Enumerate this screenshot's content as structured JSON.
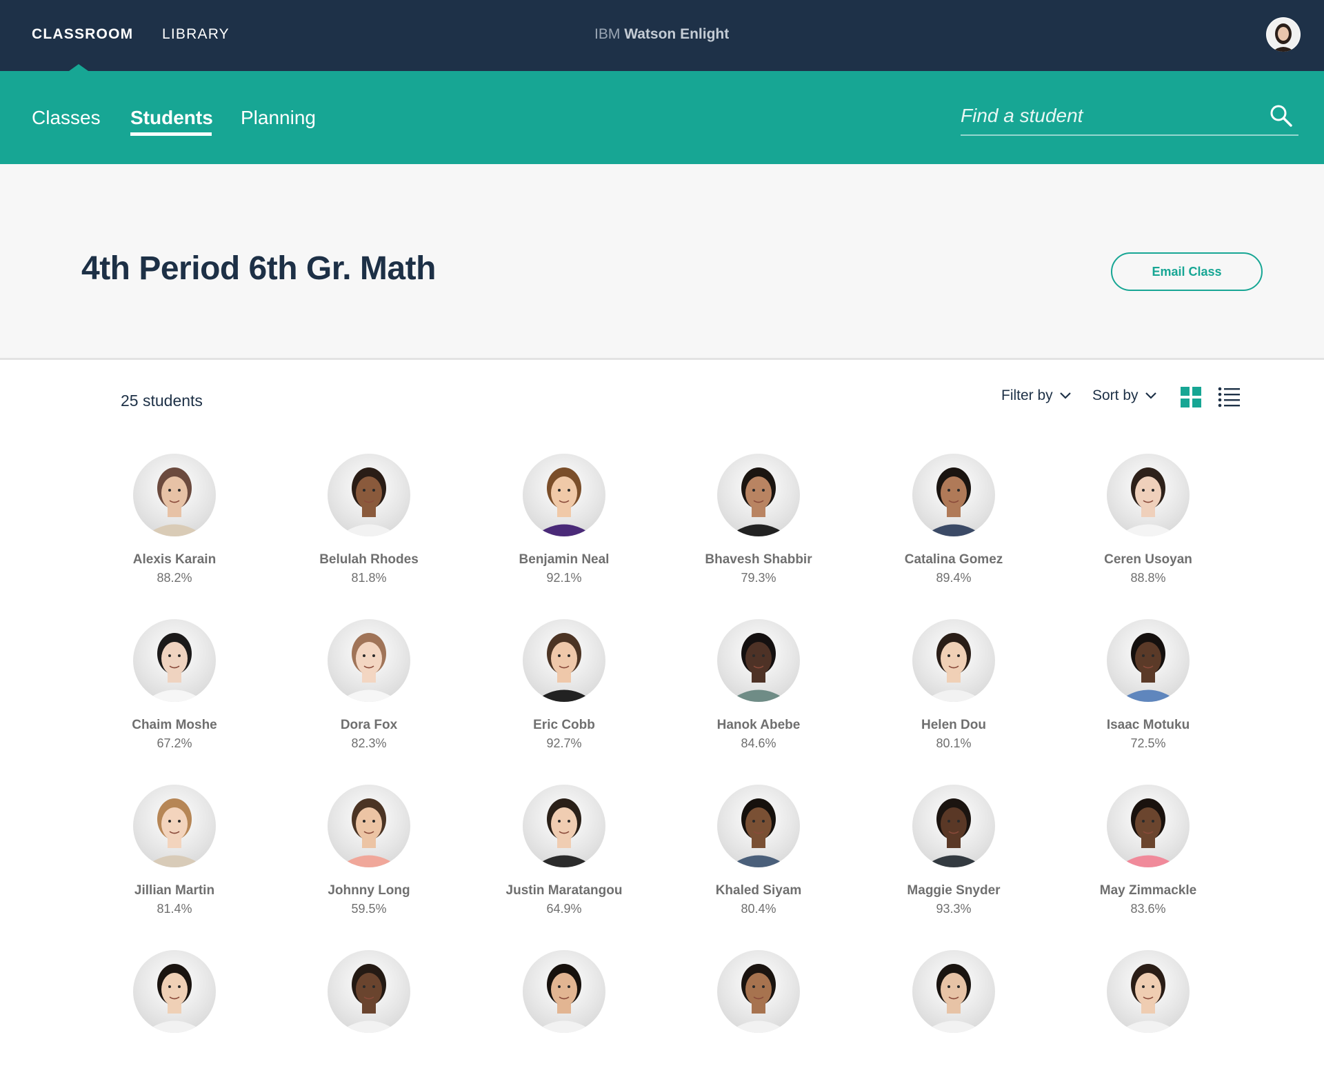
{
  "topbar": {
    "nav": [
      {
        "label": "CLASSROOM",
        "active": true
      },
      {
        "label": "LIBRARY",
        "active": false
      }
    ],
    "brand_prefix": "IBM",
    "brand_name": "Watson Enlight"
  },
  "subnav": {
    "tabs": [
      {
        "label": "Classes",
        "active": false
      },
      {
        "label": "Students",
        "active": true
      },
      {
        "label": "Planning",
        "active": false
      }
    ],
    "search_placeholder": "Find a student"
  },
  "header": {
    "title": "4th Period 6th Gr. Math",
    "email_button": "Email Class"
  },
  "toolbar": {
    "count": "25 students",
    "filter_label": "Filter by",
    "sort_label": "Sort by",
    "view_modes": [
      "grid-view",
      "list-view"
    ],
    "active_view": "grid-view"
  },
  "colors": {
    "navy": "#1e3148",
    "teal": "#17a694",
    "text_dark": "#1d3046",
    "text_muted": "#6f6f6f"
  },
  "students": [
    {
      "name": "Alexis Karain",
      "score": "88.2%",
      "hair": "#6b4a3e",
      "skin": "#e7c2a6",
      "shirt": "#d9cbb6"
    },
    {
      "name": "Belulah Rhodes",
      "score": "81.8%",
      "hair": "#2a1d16",
      "skin": "#8a5a3c",
      "shirt": "#f2f2f2"
    },
    {
      "name": "Benjamin Neal",
      "score": "92.1%",
      "hair": "#7a4e2a",
      "skin": "#f0c9a8",
      "shirt": "#4a2a78"
    },
    {
      "name": "Bhavesh Shabbir",
      "score": "79.3%",
      "hair": "#1b1511",
      "skin": "#b98462",
      "shirt": "#222222"
    },
    {
      "name": "Catalina Gomez",
      "score": "89.4%",
      "hair": "#1a1410",
      "skin": "#b07a58",
      "shirt": "#3b4a66"
    },
    {
      "name": "Ceren Usoyan",
      "score": "88.8%",
      "hair": "#2e211a",
      "skin": "#efd0bb",
      "shirt": "#f4f4f4"
    },
    {
      "name": "Chaim Moshe",
      "score": "67.2%",
      "hair": "#1c1a1a",
      "skin": "#efd3c0",
      "shirt": "#f6f6f6"
    },
    {
      "name": "Dora Fox",
      "score": "82.3%",
      "hair": "#a07458",
      "skin": "#f3d6c2",
      "shirt": "#f6f6f6"
    },
    {
      "name": "Eric Cobb",
      "score": "92.7%",
      "hair": "#4c3424",
      "skin": "#efc8aa",
      "shirt": "#222222"
    },
    {
      "name": "Hanok Abebe",
      "score": "84.6%",
      "hair": "#141010",
      "skin": "#4e3226",
      "shirt": "#6f8c86"
    },
    {
      "name": "Helen Dou",
      "score": "80.1%",
      "hair": "#2a1e17",
      "skin": "#f0d0b6",
      "shirt": "#f2f2f2"
    },
    {
      "name": "Isaac Motuku",
      "score": "72.5%",
      "hair": "#15100e",
      "skin": "#5b3a28",
      "shirt": "#5f86bd"
    },
    {
      "name": "Jillian Martin",
      "score": "81.4%",
      "hair": "#b68656",
      "skin": "#f3d4bd",
      "shirt": "#d8cbb8"
    },
    {
      "name": "Johnny Long",
      "score": "59.5%",
      "hair": "#4b3424",
      "skin": "#ecc4a4",
      "shirt": "#f0a79a"
    },
    {
      "name": "Justin Maratangou",
      "score": "64.9%",
      "hair": "#2a2018",
      "skin": "#f0cdb2",
      "shirt": "#2b2b2b"
    },
    {
      "name": "Khaled Siyam",
      "score": "80.4%",
      "hair": "#16110d",
      "skin": "#7a5034",
      "shirt": "#4a5f7a"
    },
    {
      "name": "Maggie Snyder",
      "score": "93.3%",
      "hair": "#1b1410",
      "skin": "#5a3826",
      "shirt": "#333a40"
    },
    {
      "name": "May Zimmackle",
      "score": "83.6%",
      "hair": "#1a120e",
      "skin": "#6b452e",
      "shirt": "#f08a9a"
    },
    {
      "name": "",
      "score": "",
      "hair": "#1a1410",
      "skin": "#efd0b6",
      "shirt": "#f2f2f2"
    },
    {
      "name": "",
      "score": "",
      "hair": "#241a14",
      "skin": "#6a442e",
      "shirt": "#f2f2f2"
    },
    {
      "name": "",
      "score": "",
      "hair": "#17110d",
      "skin": "#e2b592",
      "shirt": "#f2f2f2"
    },
    {
      "name": "",
      "score": "",
      "hair": "#1a1410",
      "skin": "#a7734f",
      "shirt": "#f2f2f2"
    },
    {
      "name": "",
      "score": "",
      "hair": "#1a1410",
      "skin": "#e7c3a6",
      "shirt": "#f2f2f2"
    },
    {
      "name": "",
      "score": "",
      "hair": "#2a1d16",
      "skin": "#efcdb2",
      "shirt": "#f2f2f2"
    }
  ]
}
